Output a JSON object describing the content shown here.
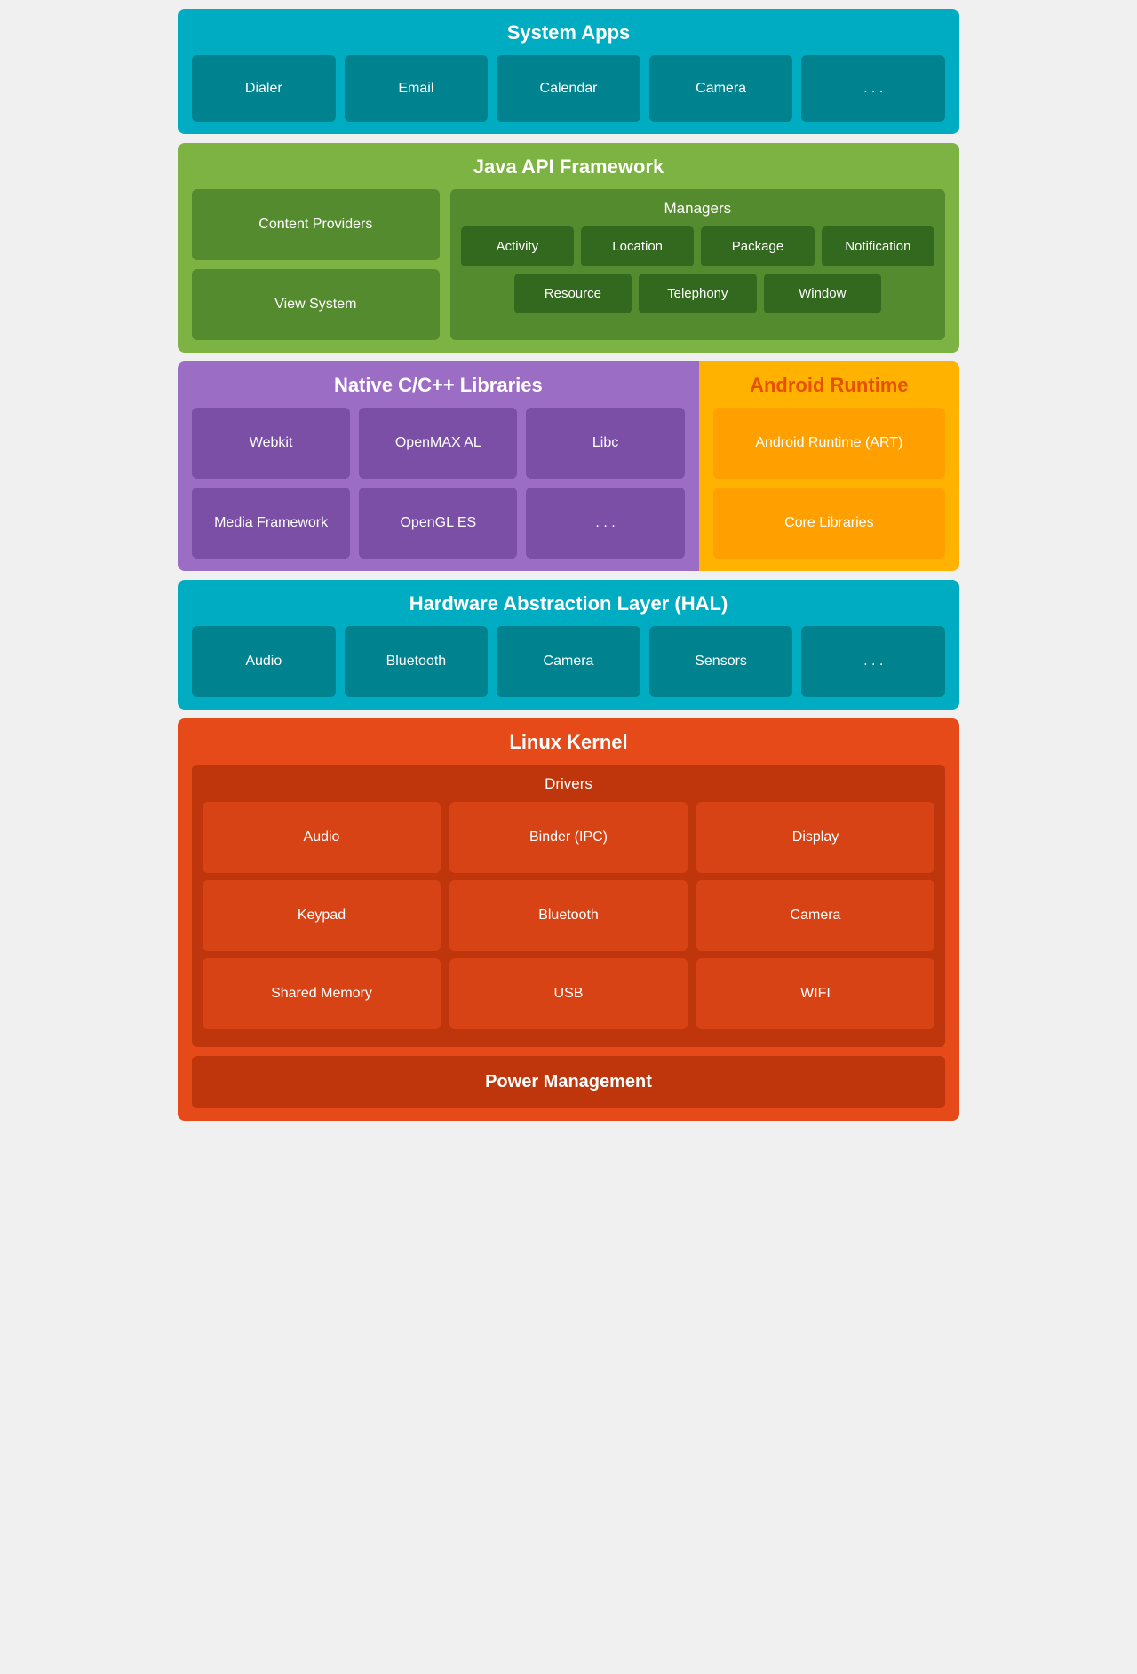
{
  "systemApps": {
    "title": "System Apps",
    "cells": [
      "Dialer",
      "Email",
      "Calendar",
      "Camera",
      ". . ."
    ]
  },
  "javaApi": {
    "title": "Java API Framework",
    "contentProviders": "Content Providers",
    "viewSystem": "View System",
    "managers": {
      "title": "Managers",
      "row1": [
        "Activity",
        "Location",
        "Package",
        "Notification"
      ],
      "row2": [
        "Resource",
        "Telephony",
        "Window"
      ]
    }
  },
  "nativeLibs": {
    "title": "Native C/C++ Libraries",
    "cells": [
      "Webkit",
      "OpenMAX AL",
      "Libc",
      "Media Framework",
      "OpenGL ES",
      ". . ."
    ]
  },
  "androidRuntime": {
    "title": "Android Runtime",
    "cells": [
      "Android Runtime (ART)",
      "Core Libraries"
    ]
  },
  "hal": {
    "title": "Hardware Abstraction Layer (HAL)",
    "cells": [
      "Audio",
      "Bluetooth",
      "Camera",
      "Sensors",
      ". . ."
    ]
  },
  "linuxKernel": {
    "title": "Linux Kernel",
    "driversTitle": "Drivers",
    "drivers": [
      [
        "Audio",
        "Binder (IPC)",
        "Display"
      ],
      [
        "Keypad",
        "Bluetooth",
        "Camera"
      ],
      [
        "Shared Memory",
        "USB",
        "WIFI"
      ]
    ],
    "powerManagement": "Power Management"
  }
}
